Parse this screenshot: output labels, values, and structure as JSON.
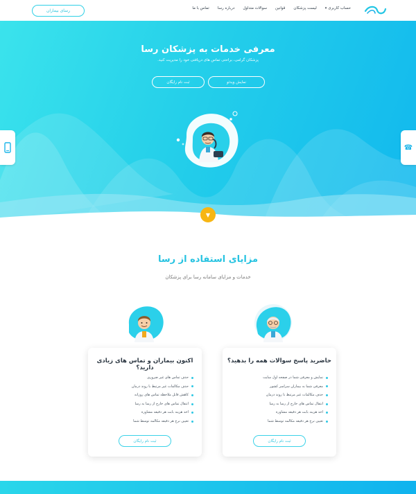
{
  "nav": {
    "cta_label": "رسای بیماران",
    "links": [
      {
        "label": "حساب کاربری",
        "has_caret": true
      },
      {
        "label": "لیست پزشکان"
      },
      {
        "label": "قوانین"
      },
      {
        "label": "سوالات متداول"
      },
      {
        "label": "درباره رسا"
      },
      {
        "label": "تماس با ما"
      }
    ]
  },
  "hero": {
    "title": "معرفی خدمات به پزشکان رسا",
    "subtitle": "پزشکان گرامی، براحتی تماس های دریافتی خود را مدیریت کنید.",
    "video_button": "نمایش ویدئو",
    "signup_button": "ثبت نام رایگان"
  },
  "benefits": {
    "title": "مزایای استفاده از رسا",
    "subtitle": "خدمات و مزایای سامانه رسا برای پزشکان"
  },
  "cards": [
    {
      "title": "حاضرید پاسخ سوالات همه را بدهید؟",
      "items": [
        "نمایش و معرفی شما در صفحه اول سایت",
        "معرفی شما به بیماران سراسر کشور",
        "حذف مکالمات غیر مرتبط با روند درمان",
        "انتقال تماس های خارج از رسا به رسا",
        "اخذ هزینه بابت هر دقیقه مشاوره",
        "تعیین نرخ هر دقیقه مکالمه توسط شما"
      ],
      "button": "ثبت نام رایگان"
    },
    {
      "title": "اکنون بیماران و تماس های زیادی دارید؟",
      "items": [
        "حذف تماس های غیر ضروری",
        "حذف مکالمات غیر مرتبط با روند درمان",
        "کاهش قابل ملاحظه تماس های روزانه",
        "انتقال تماس های خارج از رسا به رسا",
        "اخذ هزینه بابت هر دقیقه مشاوره",
        "تعیین نرخ هر دقیقه مکالمه توسط شما"
      ],
      "button": "ثبت نام رایگان"
    }
  ],
  "colors": {
    "brand_cyan": "#27c3e1",
    "hero_gradient_start": "#3be3ec",
    "hero_gradient_end": "#11b8ee",
    "accent_yellow": "#f7b613"
  },
  "icons": {
    "left_tab": "mobile-phone-icon",
    "right_tab": "telephone-icon",
    "scroll": "chevron-down-icon"
  }
}
